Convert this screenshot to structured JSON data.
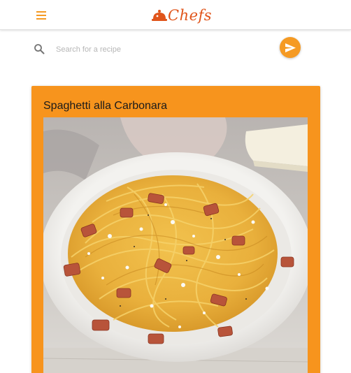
{
  "header": {
    "menu_icon": "hamburger-menu-icon",
    "logo_icon": "cloche-icon",
    "logo_text": "Chefs",
    "brand_color": "#e0541a"
  },
  "search": {
    "icon": "search-icon",
    "placeholder": "Search for a recipe",
    "value": "",
    "submit_icon": "send-icon",
    "accent_color": "#f59a23"
  },
  "recipe": {
    "title": "Spaghetti alla Carbonara",
    "card_color": "#f7941d",
    "image_alt": "Spaghetti alla Carbonara"
  }
}
